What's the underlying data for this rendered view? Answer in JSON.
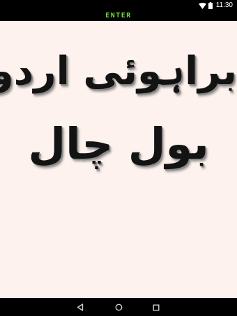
{
  "status_bar": {
    "time": "11:30",
    "icons": [
      "wifi-icon",
      "battery-icon"
    ]
  },
  "header": {
    "enter_label": "ENTER",
    "enter_color": "#78e33c"
  },
  "main": {
    "title_line1": "براہوئی اردو",
    "title_line2": "بول چال",
    "background_color": "#fdf2ee",
    "text_color": "#131313"
  },
  "nav_bar": {
    "buttons": [
      "back-icon",
      "home-icon",
      "recents-icon"
    ]
  }
}
